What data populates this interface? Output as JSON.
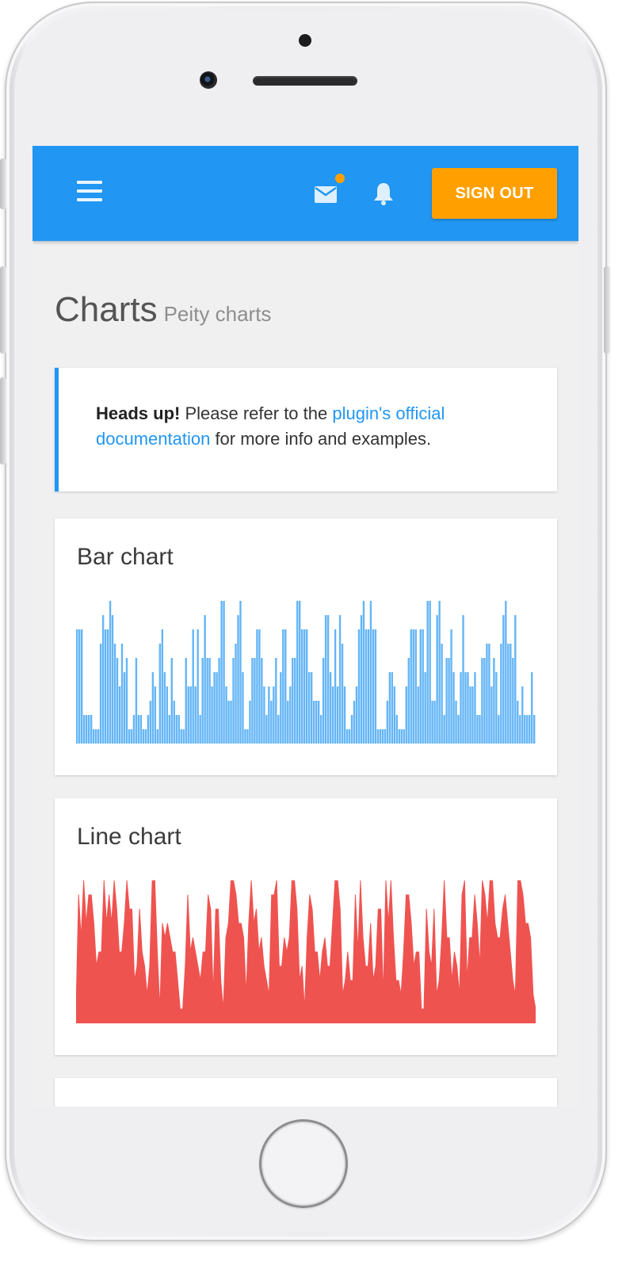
{
  "header": {
    "menu_icon": "hamburger-menu-icon",
    "mail_icon": "mail-icon",
    "bell_icon": "bell-icon",
    "notification_color": "#ffa000",
    "signout_label": "SIGN OUT",
    "signout_color": "#ffa000",
    "bar_color": "#2196f3"
  },
  "page": {
    "title": "Charts",
    "subtitle": "Peity charts"
  },
  "callout": {
    "strong": "Heads up!",
    "text_before": " Please refer to the ",
    "link_text": "plugin's official documentation",
    "text_after": " for more info and examples."
  },
  "charts": [
    {
      "title": "Bar chart",
      "color": "#64b5f6",
      "chart_data": {
        "type": "bar",
        "title": "Bar chart",
        "ylim": [
          0,
          10
        ],
        "values": [
          8,
          8,
          8,
          2,
          2,
          2,
          2,
          1,
          1,
          1,
          7,
          9,
          8,
          8,
          10,
          9,
          7,
          6,
          4,
          7,
          5,
          6,
          1,
          1,
          2,
          6,
          2,
          2,
          1,
          1,
          2,
          3,
          5,
          4,
          1,
          7,
          8,
          5,
          4,
          2,
          6,
          3,
          2,
          2,
          1,
          1,
          6,
          4,
          4,
          8,
          4,
          8,
          2,
          6,
          9,
          6,
          6,
          4,
          5,
          5,
          6,
          10,
          10,
          4,
          3,
          3,
          6,
          7,
          9,
          10,
          5,
          1,
          1,
          3,
          6,
          6,
          8,
          8,
          6,
          4,
          2,
          4,
          3,
          4,
          6,
          2,
          5,
          8,
          8,
          3,
          4,
          6,
          6,
          10,
          10,
          8,
          8,
          8,
          5,
          5,
          3,
          3,
          3,
          2,
          6,
          9,
          9,
          5,
          4,
          8,
          4,
          9,
          7,
          4,
          1,
          1,
          2,
          3,
          4,
          8,
          9,
          10,
          8,
          8,
          10,
          8,
          8,
          1,
          1,
          1,
          1,
          3,
          5,
          5,
          4,
          2,
          1,
          1,
          1,
          4,
          6,
          8,
          8,
          8,
          4,
          8,
          8,
          5,
          10,
          10,
          3,
          3,
          9,
          10,
          7,
          2,
          6,
          6,
          8,
          5,
          3,
          2,
          5,
          9,
          5,
          5,
          4,
          4,
          5,
          2,
          2,
          6,
          6,
          7,
          7,
          4,
          6,
          5,
          2,
          7,
          9,
          10,
          7,
          7,
          6,
          9,
          3,
          2,
          4,
          2,
          2,
          2,
          5,
          2
        ],
        "series": [
          {
            "name": "",
            "color": "#64b5f6"
          }
        ]
      }
    },
    {
      "title": "Line chart",
      "color": "#ef5350",
      "chart_data": {
        "type": "area",
        "title": "Line chart",
        "ylim": [
          0,
          10
        ],
        "values": [
          1,
          9,
          6,
          10,
          7,
          9,
          9,
          7,
          4,
          5,
          5,
          10,
          7,
          9,
          7,
          10,
          8,
          5,
          5,
          7,
          10,
          8,
          8,
          3,
          4,
          8,
          5,
          4,
          2,
          4,
          10,
          10,
          5,
          1,
          7,
          6,
          7,
          6,
          5,
          5,
          3,
          1,
          1,
          4,
          9,
          5,
          6,
          5,
          4,
          3,
          5,
          5,
          9,
          8,
          2,
          8,
          8,
          3,
          1,
          6,
          7,
          10,
          10,
          9,
          7,
          7,
          6,
          2,
          7,
          10,
          7,
          8,
          5,
          6,
          4,
          3,
          2,
          9,
          9,
          10,
          4,
          4,
          6,
          5,
          6,
          10,
          10,
          8,
          3,
          4,
          1,
          6,
          9,
          8,
          5,
          5,
          3,
          5,
          6,
          4,
          4,
          7,
          10,
          10,
          8,
          2,
          3,
          5,
          3,
          3,
          9,
          5,
          10,
          6,
          4,
          4,
          7,
          3,
          4,
          8,
          8,
          2,
          10,
          7,
          10,
          6,
          3,
          3,
          2,
          5,
          9,
          9,
          7,
          4,
          5,
          5,
          1,
          1,
          8,
          5,
          4,
          8,
          2,
          3,
          6,
          10,
          6,
          6,
          3,
          5,
          4,
          2,
          9,
          10,
          3,
          6,
          6,
          9,
          7,
          4,
          10,
          9,
          7,
          10,
          10,
          7,
          6,
          6,
          8,
          9,
          7,
          5,
          3,
          2,
          10,
          10,
          9,
          7,
          7,
          6,
          2,
          1
        ],
        "series": [
          {
            "name": "",
            "color": "#ef5350"
          }
        ]
      }
    }
  ]
}
